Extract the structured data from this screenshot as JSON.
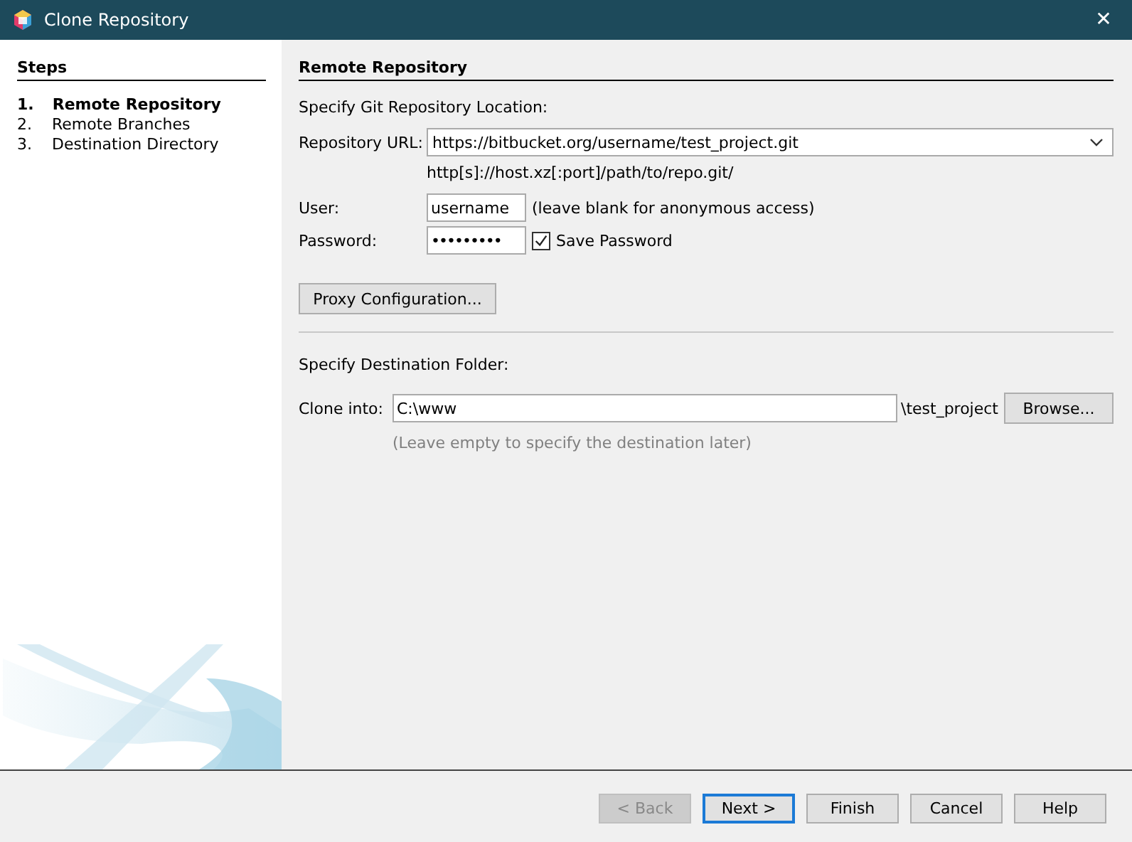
{
  "window": {
    "title": "Clone Repository",
    "close": "✕"
  },
  "steps": {
    "title": "Steps",
    "items": [
      {
        "number": "1.",
        "label": "Remote Repository",
        "selected": true
      },
      {
        "number": "2.",
        "label": "Remote Branches",
        "selected": false
      },
      {
        "number": "3.",
        "label": "Destination Directory",
        "selected": false
      }
    ]
  },
  "panel": {
    "title": "Remote Repository",
    "location_heading": "Specify Git Repository Location:",
    "url": {
      "label": "Repository URL:",
      "value": "https://bitbucket.org/username/test_project.git",
      "hint": "http[s]://host.xz[:port]/path/to/repo.git/"
    },
    "user": {
      "label": "User:",
      "value": "username",
      "note": "(leave blank for anonymous access)"
    },
    "password": {
      "label": "Password:",
      "value": "•••••••••"
    },
    "save_password": {
      "label": "Save Password",
      "checked": true
    },
    "proxy_button": "Proxy Configuration...",
    "destination_heading": "Specify Destination Folder:",
    "clone_into": {
      "label": "Clone into:",
      "value": "C:\\www",
      "suffix": "\\test_project",
      "browse": "Browse...",
      "hint": "(Leave empty to specify the destination later)"
    }
  },
  "buttons": [
    {
      "label": "< Back",
      "disabled": true,
      "default": false
    },
    {
      "label": "Next >",
      "disabled": false,
      "default": true
    },
    {
      "label": "Finish",
      "disabled": false,
      "default": false
    },
    {
      "label": "Cancel",
      "disabled": false,
      "default": false
    },
    {
      "label": "Help",
      "disabled": false,
      "default": false
    }
  ]
}
